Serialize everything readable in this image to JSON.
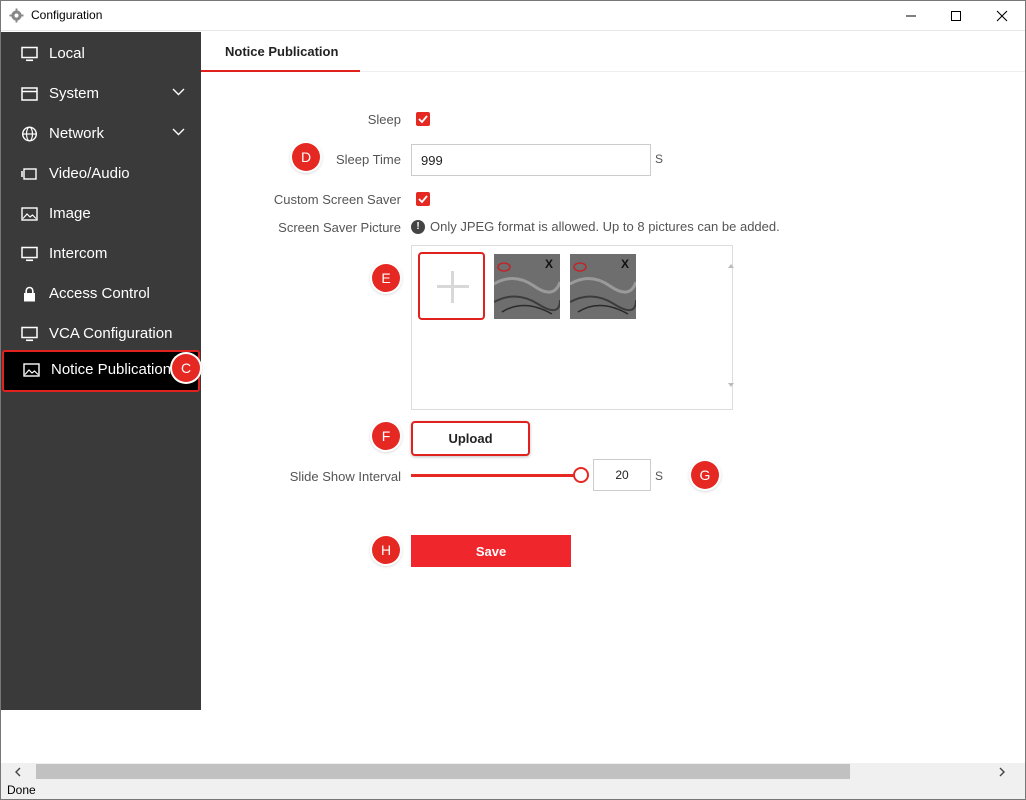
{
  "window": {
    "title": "Configuration",
    "minimize_icon": "minimize-icon",
    "maximize_icon": "maximize-icon",
    "close_icon": "close-icon"
  },
  "sidebar": {
    "items": [
      {
        "label": "Local",
        "icon": "monitor-icon"
      },
      {
        "label": "System",
        "icon": "window-icon",
        "expandable": true
      },
      {
        "label": "Network",
        "icon": "globe-icon",
        "expandable": true
      },
      {
        "label": "Video/Audio",
        "icon": "camera-icon"
      },
      {
        "label": "Image",
        "icon": "image-icon"
      },
      {
        "label": "Intercom",
        "icon": "monitor-icon"
      },
      {
        "label": "Access Control",
        "icon": "lock-icon"
      },
      {
        "label": "VCA Configuration",
        "icon": "monitor-icon"
      },
      {
        "label": "Notice Publication",
        "icon": "image-icon",
        "active": true
      }
    ]
  },
  "markers": {
    "c": "C",
    "d": "D",
    "e": "E",
    "f": "F",
    "g": "G",
    "h": "H"
  },
  "tab": {
    "label": "Notice Publication"
  },
  "form": {
    "sleep_label": "Sleep",
    "sleep_checked": true,
    "sleep_time_label": "Sleep Time",
    "sleep_time_value": "999",
    "sleep_time_unit": "S",
    "custom_screen_saver_label": "Custom Screen Saver",
    "custom_screen_saver_checked": true,
    "screen_saver_picture_label": "Screen Saver Picture",
    "picture_hint": "Only JPEG format is allowed. Up to 8 pictures can be added.",
    "thumbnail_delete": "X",
    "upload_label": "Upload",
    "slide_show_interval_label": "Slide Show Interval",
    "slide_show_interval_value": "20",
    "slide_show_interval_unit": "S",
    "save_label": "Save"
  },
  "status": {
    "text": "Done"
  },
  "colors": {
    "accent": "#e52822",
    "sidebar_bg": "#3a3a3a",
    "active_item_bg": "#000000"
  }
}
